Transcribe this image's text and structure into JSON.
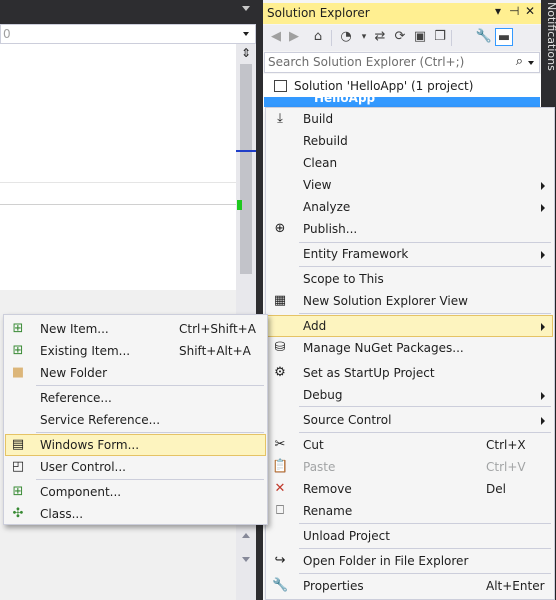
{
  "editor": {
    "nav_dropdown_value": "0"
  },
  "solution_explorer": {
    "title": "Solution Explorer",
    "title_controls": {
      "dropdown": "▾",
      "pin": "⊣",
      "close": "✕"
    },
    "search_placeholder": "Search Solution Explorer (Ctrl+;)",
    "tree": {
      "solution_label": "Solution 'HelloApp' (1 project)",
      "project_label": "HelloApp"
    }
  },
  "notifications_label": "Notifications",
  "context_menu": {
    "items": [
      {
        "label": "Build",
        "icon": "build-icon"
      },
      {
        "label": "Rebuild",
        "icon": ""
      },
      {
        "label": "Clean",
        "icon": ""
      },
      {
        "label": "View",
        "icon": "",
        "submenu": true
      },
      {
        "label": "Analyze",
        "icon": "",
        "submenu": true
      },
      {
        "label": "Publish...",
        "icon": "publish-icon"
      },
      {
        "label": "Entity Framework",
        "icon": "",
        "submenu": true
      },
      {
        "label": "Scope to This",
        "icon": ""
      },
      {
        "label": "New Solution Explorer View",
        "icon": "new-view-icon"
      },
      {
        "label": "Add",
        "icon": "",
        "submenu": true,
        "highlighted": true
      },
      {
        "label": "Manage NuGet Packages...",
        "icon": "nuget-icon"
      },
      {
        "label": "Set as StartUp Project",
        "icon": "gear-icon"
      },
      {
        "label": "Debug",
        "icon": "",
        "submenu": true
      },
      {
        "label": "Source Control",
        "icon": "",
        "submenu": true
      },
      {
        "label": "Cut",
        "icon": "scissors-icon",
        "shortcut": "Ctrl+X"
      },
      {
        "label": "Paste",
        "icon": "paste-icon",
        "shortcut": "Ctrl+V",
        "disabled": true
      },
      {
        "label": "Remove",
        "icon": "remove-icon",
        "shortcut": "Del"
      },
      {
        "label": "Rename",
        "icon": "rename-icon"
      },
      {
        "label": "Unload Project",
        "icon": ""
      },
      {
        "label": "Open Folder in File Explorer",
        "icon": "folder-open-icon"
      },
      {
        "label": "Properties",
        "icon": "wrench-icon",
        "shortcut": "Alt+Enter"
      }
    ]
  },
  "add_submenu": {
    "items": [
      {
        "label": "New Item...",
        "icon": "new-item-icon",
        "shortcut": "Ctrl+Shift+A"
      },
      {
        "label": "Existing Item...",
        "icon": "existing-item-icon",
        "shortcut": "Shift+Alt+A"
      },
      {
        "label": "New Folder",
        "icon": "folder-icon"
      },
      {
        "label": "Reference...",
        "icon": ""
      },
      {
        "label": "Service Reference...",
        "icon": ""
      },
      {
        "label": "Windows Form...",
        "icon": "windows-form-icon",
        "highlighted": true
      },
      {
        "label": "User Control...",
        "icon": "user-control-icon"
      },
      {
        "label": "Component...",
        "icon": "component-icon"
      },
      {
        "label": "Class...",
        "icon": "class-icon"
      }
    ]
  },
  "colors": {
    "title_active": "#ffef91",
    "selection": "#3399ff",
    "menu_highlight": "#fdf4bf",
    "remove_icon": "#c0392b"
  }
}
